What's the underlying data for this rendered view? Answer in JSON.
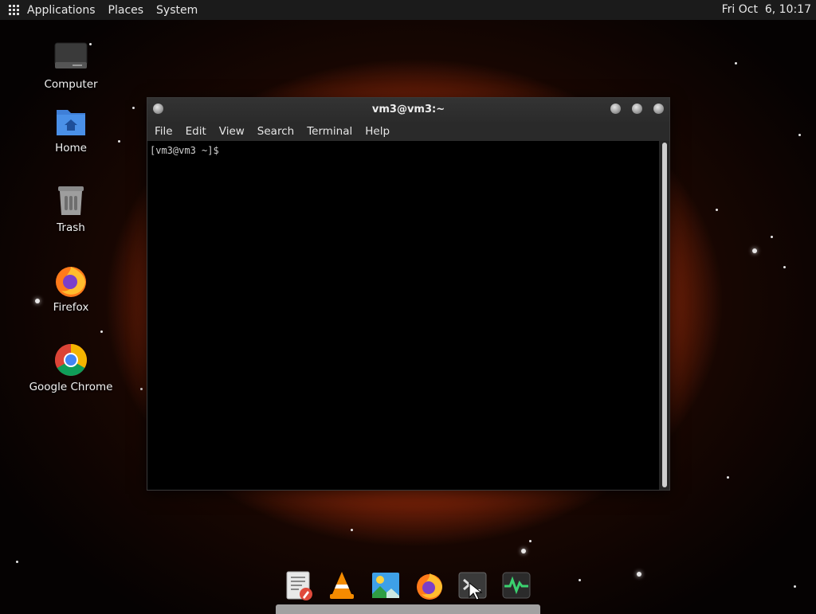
{
  "top_panel": {
    "menus": [
      "Applications",
      "Places",
      "System"
    ],
    "clock": "Fri Oct  6, 10:17"
  },
  "desktop_icons": [
    {
      "label": "Computer",
      "icon": "computer-icon"
    },
    {
      "label": "Home",
      "icon": "home-folder-icon"
    },
    {
      "label": "Trash",
      "icon": "trash-icon"
    },
    {
      "label": "Firefox",
      "icon": "firefox-icon"
    },
    {
      "label": "Google Chrome",
      "icon": "chrome-icon"
    }
  ],
  "terminal": {
    "title": "vm3@vm3:~",
    "menu": [
      "File",
      "Edit",
      "View",
      "Search",
      "Terminal",
      "Help"
    ],
    "prompt": "[vm3@vm3 ~]$"
  },
  "dock": [
    {
      "icon": "text-editor-icon"
    },
    {
      "icon": "vlc-icon"
    },
    {
      "icon": "image-viewer-icon"
    },
    {
      "icon": "firefox-icon"
    },
    {
      "icon": "terminal-icon"
    },
    {
      "icon": "system-monitor-icon"
    }
  ],
  "colors": {
    "panel": "#1b1b1b",
    "window": "#262626",
    "terminal_bg": "#000000",
    "nebula": "#c2451a"
  }
}
